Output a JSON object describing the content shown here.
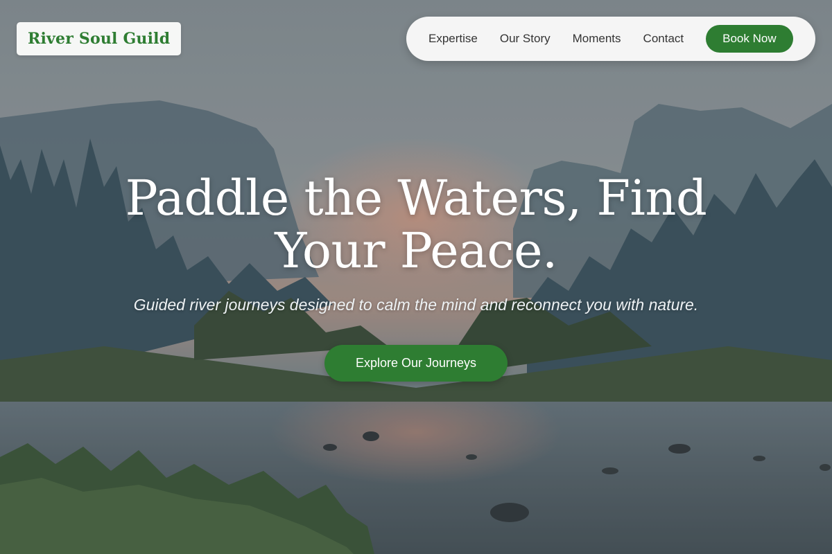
{
  "brand": {
    "name": "River Soul Guild",
    "color": "#2e7d32"
  },
  "nav": {
    "links": [
      "Expertise",
      "Our Story",
      "Moments",
      "Contact"
    ],
    "book_label": "Book Now"
  },
  "hero": {
    "title": "Paddle the Waters, Find Your Peace.",
    "subtitle": "Guided river journeys designed to calm the mind and reconnect you with nature.",
    "cta_label": "Explore Our Journeys"
  },
  "colors": {
    "accent": "#2e7d32",
    "nav_background": "#f5f5f5"
  }
}
